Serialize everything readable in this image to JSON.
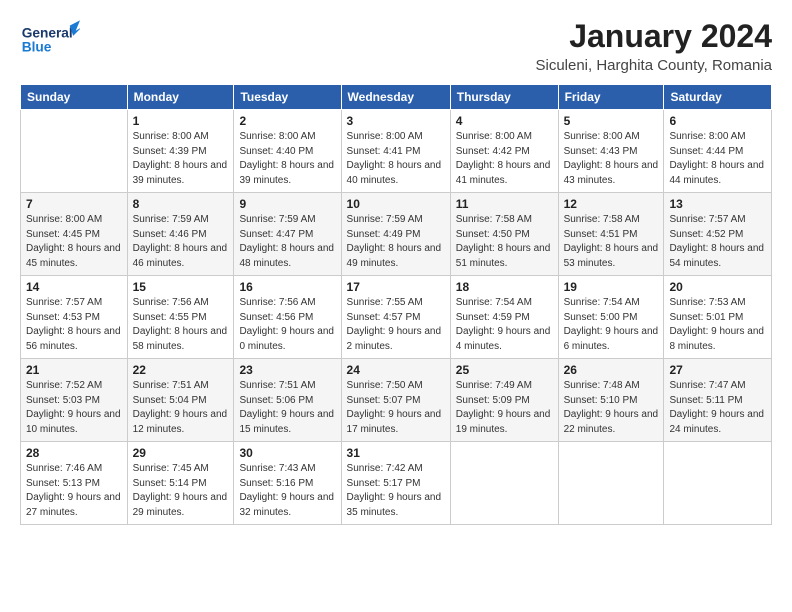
{
  "header": {
    "logo_line1": "General",
    "logo_line2": "Blue",
    "month": "January 2024",
    "location": "Siculeni, Harghita County, Romania"
  },
  "weekdays": [
    "Sunday",
    "Monday",
    "Tuesday",
    "Wednesday",
    "Thursday",
    "Friday",
    "Saturday"
  ],
  "weeks": [
    [
      {
        "day": "",
        "sunrise": "",
        "sunset": "",
        "daylight": ""
      },
      {
        "day": "1",
        "sunrise": "Sunrise: 8:00 AM",
        "sunset": "Sunset: 4:39 PM",
        "daylight": "Daylight: 8 hours and 39 minutes."
      },
      {
        "day": "2",
        "sunrise": "Sunrise: 8:00 AM",
        "sunset": "Sunset: 4:40 PM",
        "daylight": "Daylight: 8 hours and 39 minutes."
      },
      {
        "day": "3",
        "sunrise": "Sunrise: 8:00 AM",
        "sunset": "Sunset: 4:41 PM",
        "daylight": "Daylight: 8 hours and 40 minutes."
      },
      {
        "day": "4",
        "sunrise": "Sunrise: 8:00 AM",
        "sunset": "Sunset: 4:42 PM",
        "daylight": "Daylight: 8 hours and 41 minutes."
      },
      {
        "day": "5",
        "sunrise": "Sunrise: 8:00 AM",
        "sunset": "Sunset: 4:43 PM",
        "daylight": "Daylight: 8 hours and 43 minutes."
      },
      {
        "day": "6",
        "sunrise": "Sunrise: 8:00 AM",
        "sunset": "Sunset: 4:44 PM",
        "daylight": "Daylight: 8 hours and 44 minutes."
      }
    ],
    [
      {
        "day": "7",
        "sunrise": "Sunrise: 8:00 AM",
        "sunset": "Sunset: 4:45 PM",
        "daylight": "Daylight: 8 hours and 45 minutes."
      },
      {
        "day": "8",
        "sunrise": "Sunrise: 7:59 AM",
        "sunset": "Sunset: 4:46 PM",
        "daylight": "Daylight: 8 hours and 46 minutes."
      },
      {
        "day": "9",
        "sunrise": "Sunrise: 7:59 AM",
        "sunset": "Sunset: 4:47 PM",
        "daylight": "Daylight: 8 hours and 48 minutes."
      },
      {
        "day": "10",
        "sunrise": "Sunrise: 7:59 AM",
        "sunset": "Sunset: 4:49 PM",
        "daylight": "Daylight: 8 hours and 49 minutes."
      },
      {
        "day": "11",
        "sunrise": "Sunrise: 7:58 AM",
        "sunset": "Sunset: 4:50 PM",
        "daylight": "Daylight: 8 hours and 51 minutes."
      },
      {
        "day": "12",
        "sunrise": "Sunrise: 7:58 AM",
        "sunset": "Sunset: 4:51 PM",
        "daylight": "Daylight: 8 hours and 53 minutes."
      },
      {
        "day": "13",
        "sunrise": "Sunrise: 7:57 AM",
        "sunset": "Sunset: 4:52 PM",
        "daylight": "Daylight: 8 hours and 54 minutes."
      }
    ],
    [
      {
        "day": "14",
        "sunrise": "Sunrise: 7:57 AM",
        "sunset": "Sunset: 4:53 PM",
        "daylight": "Daylight: 8 hours and 56 minutes."
      },
      {
        "day": "15",
        "sunrise": "Sunrise: 7:56 AM",
        "sunset": "Sunset: 4:55 PM",
        "daylight": "Daylight: 8 hours and 58 minutes."
      },
      {
        "day": "16",
        "sunrise": "Sunrise: 7:56 AM",
        "sunset": "Sunset: 4:56 PM",
        "daylight": "Daylight: 9 hours and 0 minutes."
      },
      {
        "day": "17",
        "sunrise": "Sunrise: 7:55 AM",
        "sunset": "Sunset: 4:57 PM",
        "daylight": "Daylight: 9 hours and 2 minutes."
      },
      {
        "day": "18",
        "sunrise": "Sunrise: 7:54 AM",
        "sunset": "Sunset: 4:59 PM",
        "daylight": "Daylight: 9 hours and 4 minutes."
      },
      {
        "day": "19",
        "sunrise": "Sunrise: 7:54 AM",
        "sunset": "Sunset: 5:00 PM",
        "daylight": "Daylight: 9 hours and 6 minutes."
      },
      {
        "day": "20",
        "sunrise": "Sunrise: 7:53 AM",
        "sunset": "Sunset: 5:01 PM",
        "daylight": "Daylight: 9 hours and 8 minutes."
      }
    ],
    [
      {
        "day": "21",
        "sunrise": "Sunrise: 7:52 AM",
        "sunset": "Sunset: 5:03 PM",
        "daylight": "Daylight: 9 hours and 10 minutes."
      },
      {
        "day": "22",
        "sunrise": "Sunrise: 7:51 AM",
        "sunset": "Sunset: 5:04 PM",
        "daylight": "Daylight: 9 hours and 12 minutes."
      },
      {
        "day": "23",
        "sunrise": "Sunrise: 7:51 AM",
        "sunset": "Sunset: 5:06 PM",
        "daylight": "Daylight: 9 hours and 15 minutes."
      },
      {
        "day": "24",
        "sunrise": "Sunrise: 7:50 AM",
        "sunset": "Sunset: 5:07 PM",
        "daylight": "Daylight: 9 hours and 17 minutes."
      },
      {
        "day": "25",
        "sunrise": "Sunrise: 7:49 AM",
        "sunset": "Sunset: 5:09 PM",
        "daylight": "Daylight: 9 hours and 19 minutes."
      },
      {
        "day": "26",
        "sunrise": "Sunrise: 7:48 AM",
        "sunset": "Sunset: 5:10 PM",
        "daylight": "Daylight: 9 hours and 22 minutes."
      },
      {
        "day": "27",
        "sunrise": "Sunrise: 7:47 AM",
        "sunset": "Sunset: 5:11 PM",
        "daylight": "Daylight: 9 hours and 24 minutes."
      }
    ],
    [
      {
        "day": "28",
        "sunrise": "Sunrise: 7:46 AM",
        "sunset": "Sunset: 5:13 PM",
        "daylight": "Daylight: 9 hours and 27 minutes."
      },
      {
        "day": "29",
        "sunrise": "Sunrise: 7:45 AM",
        "sunset": "Sunset: 5:14 PM",
        "daylight": "Daylight: 9 hours and 29 minutes."
      },
      {
        "day": "30",
        "sunrise": "Sunrise: 7:43 AM",
        "sunset": "Sunset: 5:16 PM",
        "daylight": "Daylight: 9 hours and 32 minutes."
      },
      {
        "day": "31",
        "sunrise": "Sunrise: 7:42 AM",
        "sunset": "Sunset: 5:17 PM",
        "daylight": "Daylight: 9 hours and 35 minutes."
      },
      {
        "day": "",
        "sunrise": "",
        "sunset": "",
        "daylight": ""
      },
      {
        "day": "",
        "sunrise": "",
        "sunset": "",
        "daylight": ""
      },
      {
        "day": "",
        "sunrise": "",
        "sunset": "",
        "daylight": ""
      }
    ]
  ]
}
